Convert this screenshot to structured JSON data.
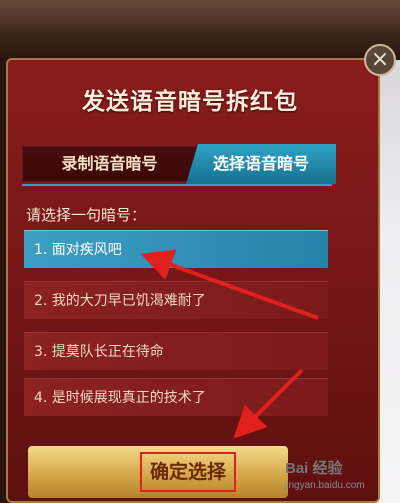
{
  "dialog": {
    "title": "发送语音暗号拆红包",
    "close_icon": "×",
    "tabs": [
      {
        "label": "录制语音暗号",
        "active": false
      },
      {
        "label": "选择语音暗号",
        "active": true
      }
    ],
    "prompt": "请选择一句暗号：",
    "options": [
      {
        "label": "1. 面对疾风吧",
        "selected": true
      },
      {
        "label": "2. 我的大刀早已饥渴难耐了",
        "selected": false
      },
      {
        "label": "3. 提莫队长正在待命",
        "selected": false
      },
      {
        "label": "4. 是时候展现真正的技术了",
        "selected": false
      }
    ],
    "confirm_label": "确定选择"
  },
  "watermark": {
    "logo": "Bai 经验",
    "url": "jingyan.baidu.com"
  },
  "colors": {
    "dialog_red": "#7a1717",
    "selected_blue": "#2f92b8",
    "arrow_red": "#e0201c",
    "gold": "#d6a84b"
  }
}
